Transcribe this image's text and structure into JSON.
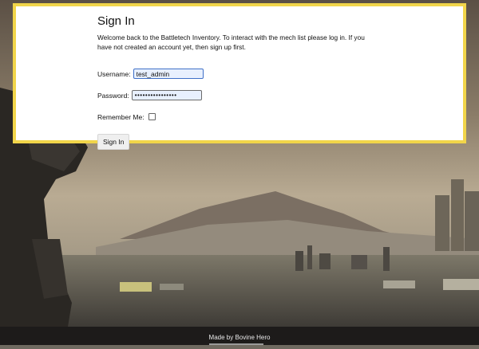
{
  "colors": {
    "card_border": "#f1d54a",
    "footer_bg": "#1d1b1a"
  },
  "login": {
    "title": "Sign In",
    "intro": "Welcome back to the Battletech Inventory. To interact with the mech list please log in. If you have not created an account yet, then sign up first.",
    "username_label": "Username:",
    "username_value": "test_admin",
    "password_label": "Password:",
    "password_value": "••••••••••••••••",
    "remember_label": "Remember Me:",
    "remember_checked": false,
    "submit_label": "Sign In"
  },
  "footer": {
    "credit": "Made by Bovine Hero"
  }
}
